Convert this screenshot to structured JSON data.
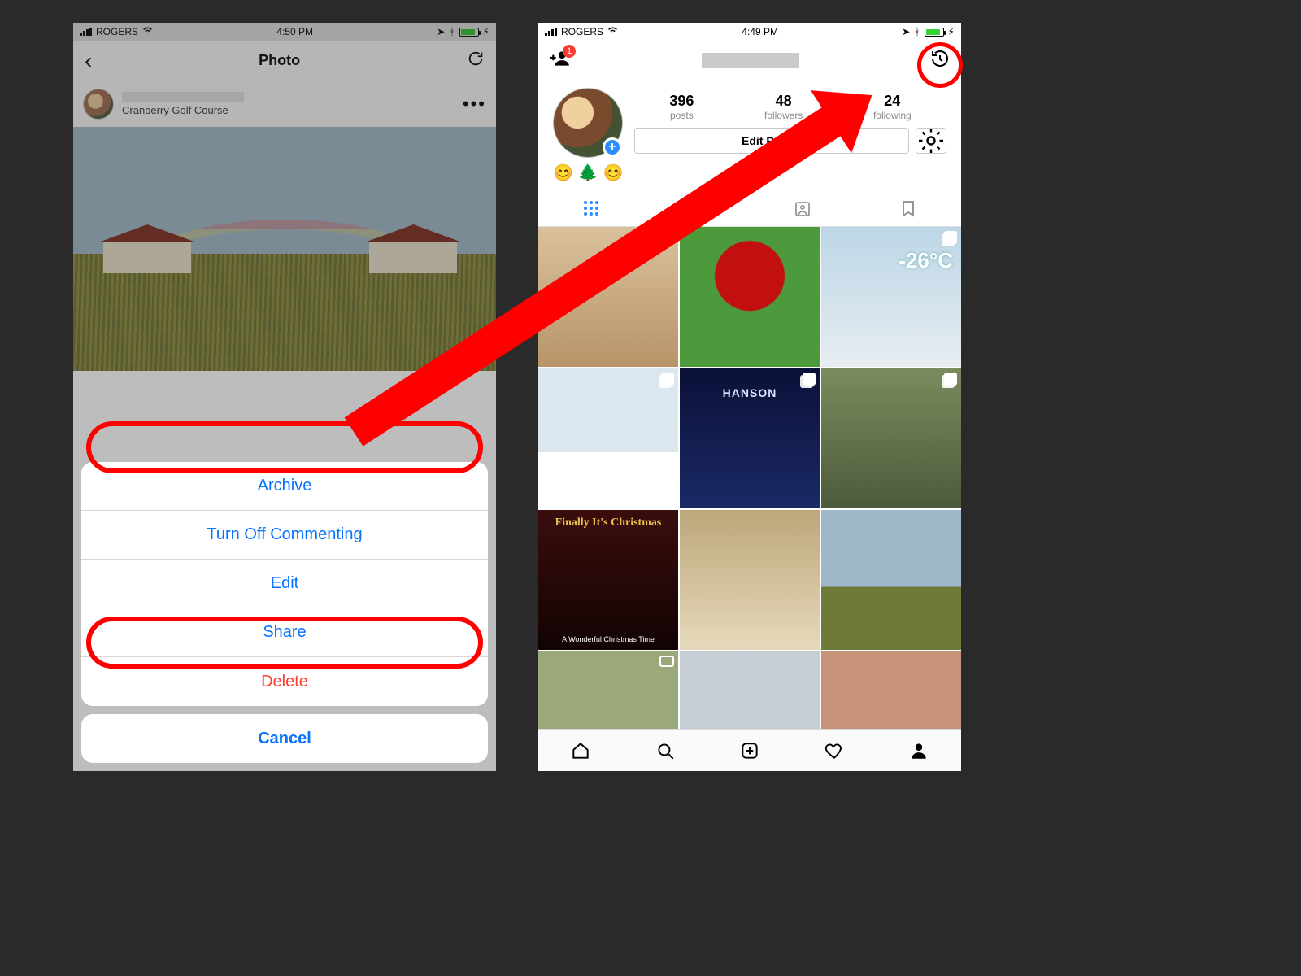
{
  "left": {
    "status": {
      "carrier": "ROGERS",
      "time": "4:50 PM"
    },
    "nav": {
      "title": "Photo"
    },
    "post": {
      "location": "Cranberry Golf Course"
    },
    "sheet": {
      "items": [
        {
          "label": "Archive",
          "destructive": false
        },
        {
          "label": "Turn Off Commenting",
          "destructive": false
        },
        {
          "label": "Edit",
          "destructive": false
        },
        {
          "label": "Share",
          "destructive": false
        },
        {
          "label": "Delete",
          "destructive": true
        }
      ],
      "cancel": "Cancel"
    }
  },
  "right": {
    "status": {
      "carrier": "ROGERS",
      "time": "4:49 PM"
    },
    "badge": "1",
    "stats": {
      "posts": {
        "value": "396",
        "label": "posts"
      },
      "followers": {
        "value": "48",
        "label": "followers"
      },
      "following": {
        "value": "24",
        "label": "following"
      }
    },
    "edit_label": "Edit Profile",
    "highlight_emoji": "😊🌲😊",
    "grid": {
      "cold_text": "-26°C",
      "concert_text": "HANSON",
      "xmas_title": "Finally It's Christmas",
      "xmas_sub": "A Wonderful Christmas Time"
    }
  },
  "annotations": {
    "highlighted_actions": [
      "Archive",
      "Delete"
    ],
    "arrow_target": "archive-history-icon"
  }
}
